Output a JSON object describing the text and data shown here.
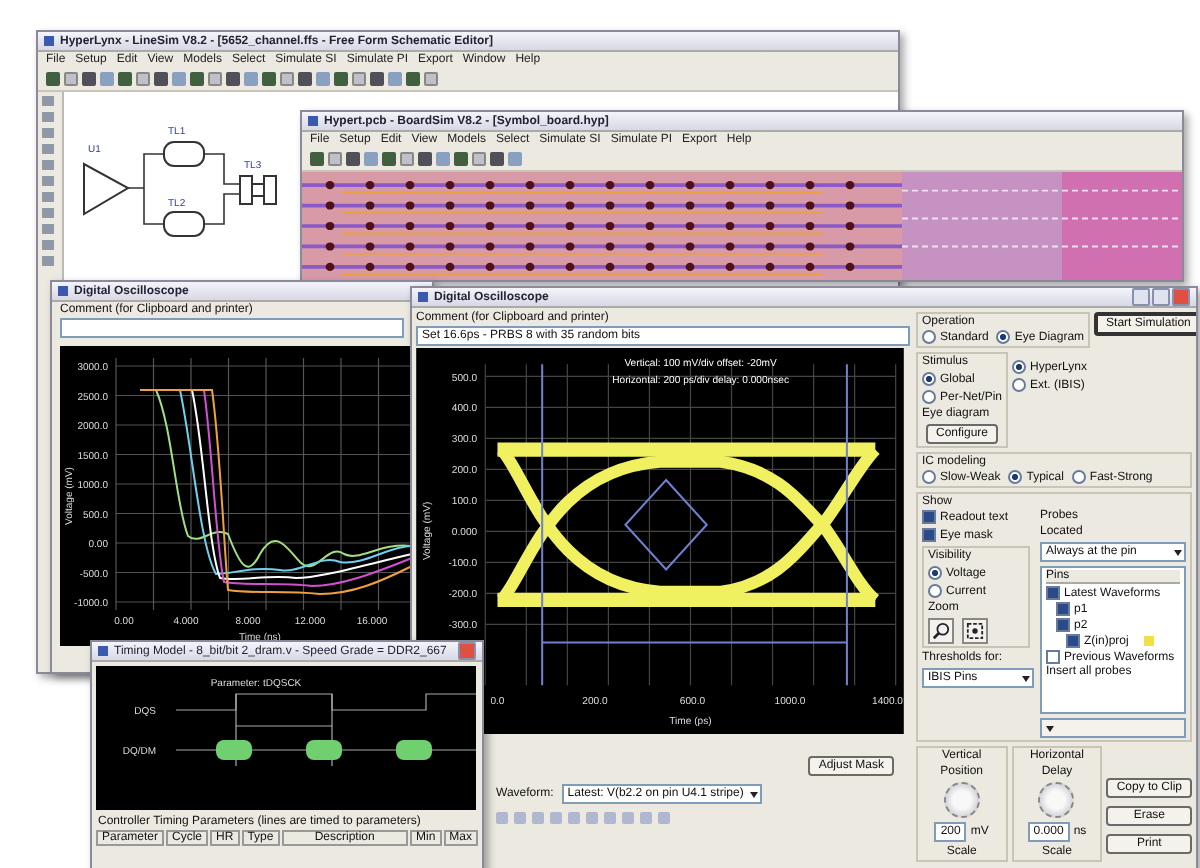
{
  "linesim": {
    "title": "HyperLynx - LineSim V8.2 - [5652_channel.ffs - Free Form Schematic Editor]",
    "menu": [
      "File",
      "Setup",
      "Edit",
      "View",
      "Models",
      "Select",
      "Simulate SI",
      "Simulate PI",
      "Export",
      "Window",
      "Help"
    ],
    "parts": [
      "U1",
      "TL1",
      "TL2",
      "TL3"
    ]
  },
  "boardsim": {
    "title": "Hypert.pcb - BoardSim V8.2 - [Symbol_board.hyp]",
    "menu": [
      "File",
      "Setup",
      "Edit",
      "View",
      "Models",
      "Select",
      "Simulate SI",
      "Simulate PI",
      "Export",
      "Help"
    ]
  },
  "scope_small": {
    "title": "Digital Oscilloscope",
    "comment_label": "Comment (for Clipboard and printer)",
    "yticks": [
      "3000.0",
      "2500.0",
      "2000.0",
      "1500.0",
      "1000.0",
      "500.0",
      "0.00",
      "-500.0",
      "-1000.0"
    ],
    "xticks": [
      "0.00",
      "4.000",
      "8.000",
      "12.000",
      "16.000"
    ],
    "xlabel": "Time (ns)",
    "ylabel": "Voltage (mV)"
  },
  "scope_main": {
    "title": "Digital Oscilloscope",
    "comment_label": "Comment (for Clipboard and printer)",
    "comment": "Set 16.6ps - PRBS 8 with 35 random bits",
    "readout": [
      "Vertical: 100 mV/div  offset: -20mV",
      "Horizontal: 200 ps/div  delay: 0.000nsec"
    ],
    "yticks": [
      "500.0",
      "400.0",
      "300.0",
      "200.0",
      "100.0",
      "0.000",
      "-100.0",
      "-200.0",
      "-300.0"
    ],
    "xticks": [
      "0.0",
      "200.0",
      "600.0",
      "1000.0",
      "1400.0"
    ],
    "xlabel": "Time (ps)",
    "ylabel": "Voltage (mV)",
    "operation": {
      "label": "Operation",
      "options": [
        {
          "label": "Standard",
          "selected": false
        },
        {
          "label": "Eye Diagram",
          "selected": true
        }
      ]
    },
    "start_button": "Start Simulation",
    "stimulus": {
      "label": "Stimulus",
      "options": [
        {
          "label": "Global",
          "selected": true
        },
        {
          "label": "Per-Net/Pin",
          "selected": false
        }
      ],
      "sub_label": "Eye diagram",
      "button": "Configure"
    },
    "engine": [
      {
        "label": "HyperLynx",
        "selected": true
      },
      {
        "label": "Ext. (IBIS)",
        "selected": false
      }
    ],
    "ic_modeling": {
      "label": "IC modeling",
      "options": [
        {
          "label": "Slow-Weak",
          "selected": false
        },
        {
          "label": "Typical",
          "selected": true
        },
        {
          "label": "Fast-Strong",
          "selected": false
        }
      ]
    },
    "show": {
      "label": "Show",
      "checks": [
        {
          "label": "Readout text",
          "checked": true
        },
        {
          "label": "Eye mask",
          "checked": true
        }
      ]
    },
    "probes": {
      "label": "Probes",
      "located_label": "Located",
      "located": "Always at the pin",
      "list_header": "Pins",
      "tree": [
        {
          "label": "Latest Waveforms",
          "checked": true,
          "children": [
            {
              "label": "p1",
              "checked": true
            },
            {
              "label": "p2",
              "checked": true,
              "children": [
                {
                  "label": "Z(in)proj",
                  "checked": true,
                  "color": "#f0e040"
                }
              ]
            }
          ]
        },
        {
          "label": "Previous Waveforms",
          "checked": false
        }
      ],
      "insert": "Insert all probes"
    },
    "visibility": {
      "label": "Visibility",
      "options": [
        {
          "label": "Voltage",
          "selected": true
        },
        {
          "label": "Current",
          "selected": false
        }
      ]
    },
    "zoom_label": "Zoom",
    "threshold": {
      "label": "Thresholds for:",
      "value": "IBIS Pins"
    },
    "vertical": {
      "label": "Vertical",
      "knob_label": "Position",
      "value": "200",
      "unit": "mV",
      "scale_label": "Scale"
    },
    "horizontal": {
      "label": "Horizontal",
      "knob_label": "Delay",
      "value": "0.000",
      "unit": "ns",
      "scale_label": "Scale"
    },
    "buttons": [
      "Copy to Clip",
      "Erase",
      "Print"
    ],
    "adjust_button": "Adjust Mask",
    "waveform": {
      "label": "Waveform:",
      "value": "Latest: V(b2.2 on pin U4.1 stripe)"
    }
  },
  "timing": {
    "title": "Timing Model - 8_bit/bit 2_dram.v - Speed Grade = DDR2_667",
    "parameter": "Parameter: tDQSCK",
    "signals": [
      "DQS",
      "DQ/DM"
    ],
    "table_title": "Controller Timing Parameters (lines are timed to parameters)",
    "columns": [
      "Parameter",
      "Cycle",
      "HR",
      "Type",
      "Description",
      "Min",
      "Max"
    ]
  }
}
